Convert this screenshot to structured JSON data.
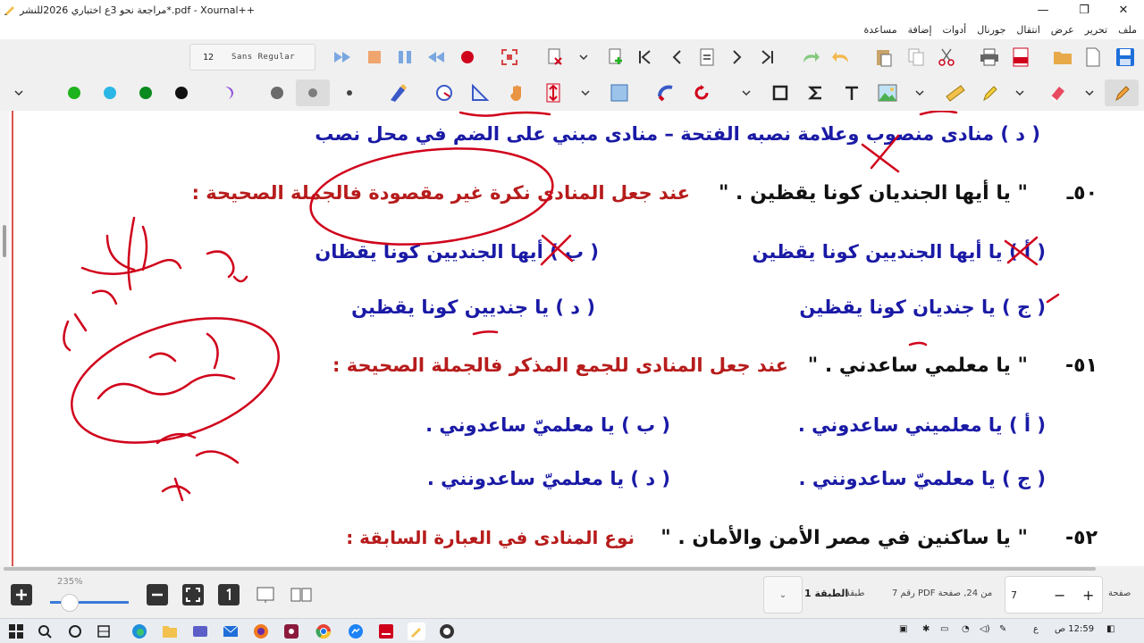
{
  "window": {
    "title": "مراجعة نحو 3ع اختباري 2026للنشر*.pdf - Xournal++",
    "minimize": "—",
    "restore": "❐",
    "close": "✕"
  },
  "menu": [
    "ملف",
    "تحرير",
    "عرض",
    "انتقال",
    "جورنال",
    "أدوات",
    "إضافة",
    "مساعدة"
  ],
  "font_box": {
    "size": "12",
    "name": "Sans Regular"
  },
  "colors": {
    "green": "#1db31d",
    "cyan": "#2ab7e6",
    "dark_green": "#0b8a1e",
    "black": "#111111",
    "purple": "#8b4fd6",
    "gray": "#6b6b6b",
    "lightgray": "#7d7d7d"
  },
  "document": {
    "q_prev_option_d": "( د ) منادى منصوب وعلامة نصبه الفتحة – منادى مبني على الضم في محل نصب",
    "q50": {
      "number": "٥٠ـ",
      "quote": "\" يا أيها الجنديان كونا يقظين . \"",
      "instruction": "عند جعل المنادى نكرة غير مقصودة فالجملة الصحيحة :",
      "a": "( أ ) يا أيها الجنديين كونا يقظين",
      "b": "( ب ) أيها الجنديين كونا يقظان",
      "c": "( ج ) يا جنديان كونا يقظين",
      "d": "( د ) يا جنديين كونا يقظين"
    },
    "q51": {
      "number": "٥١-",
      "quote": "\" يا معلمي ساعدني . \"",
      "instruction": "عند جعل المنادى للجمع المذكر فالجملة الصحيحة :",
      "a": "( أ ) يا معلميني ساعدوني .",
      "b": "( ب ) يا معلميّ ساعدوني .",
      "c": "( ج ) يا معلميّ ساعدونني .",
      "d": "( د ) يا معلميّ ساعدونني ."
    },
    "q52": {
      "number": "٥٢-",
      "quote": "\" يا ساكنين في مصر الأمن والأمان . \"",
      "instruction": "نوع المنادى في العبارة السابقة :"
    }
  },
  "bottom": {
    "zoom": "235%",
    "page_label": "صفحة",
    "page_value": "7",
    "page_of": "من 24, صفحة PDF رقم 7",
    "layer_label": "طبقة",
    "layer_value": "الطبقة 1"
  },
  "taskbar": {
    "time": "12:59 ص",
    "lang": "ع"
  }
}
